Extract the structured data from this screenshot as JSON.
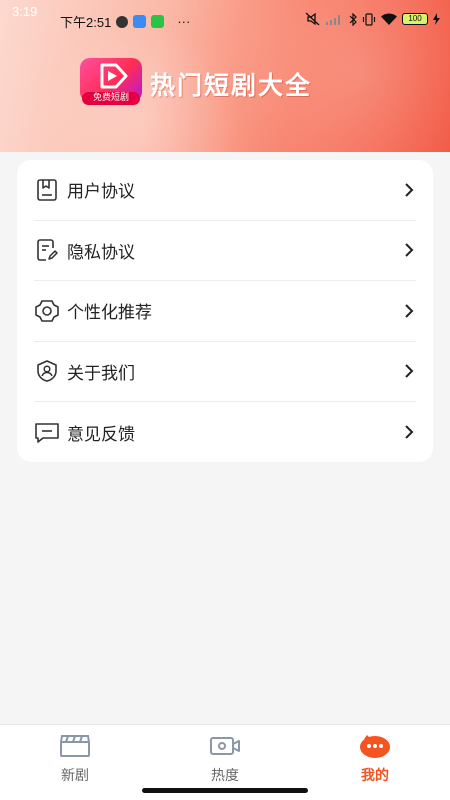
{
  "status_bar": {
    "clock": "3:19",
    "notification_time": "下午2:51",
    "more": "···",
    "battery": "100"
  },
  "header": {
    "app_title": "热门短剧大全",
    "logo_tag": "免费短剧",
    "colors": {
      "gradient_start": "#fcd9cf",
      "gradient_end": "#f25a45"
    }
  },
  "menu": {
    "items": [
      {
        "label": "用户协议",
        "icon": "document-icon"
      },
      {
        "label": "隐私协议",
        "icon": "edit-document-icon"
      },
      {
        "label": "个性化推荐",
        "icon": "settings-gear-icon"
      },
      {
        "label": "关于我们",
        "icon": "shield-user-icon"
      },
      {
        "label": "意见反馈",
        "icon": "message-icon"
      }
    ]
  },
  "bottom_nav": {
    "items": [
      {
        "label": "新剧",
        "icon": "clapperboard-icon",
        "active": false
      },
      {
        "label": "热度",
        "icon": "video-camera-icon",
        "active": false
      },
      {
        "label": "我的",
        "icon": "mascot-icon",
        "active": true
      }
    ],
    "active_color": "#f5531f"
  }
}
